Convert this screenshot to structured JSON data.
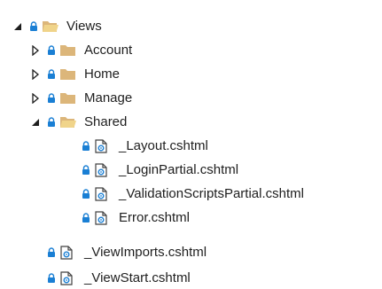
{
  "colors": {
    "folder": "#dcb67a",
    "folder_open_front": "#f0d48a",
    "lock": "#1a7fd4",
    "file_outline": "#424242",
    "file_badge": "#1a7fd4",
    "arrow": "#1e1e1e"
  },
  "tree": {
    "root": {
      "label": "Views",
      "state": "expanded",
      "icon": "folder-open-icon"
    },
    "folders": [
      {
        "label": "Account",
        "state": "collapsed",
        "icon": "folder-closed-icon"
      },
      {
        "label": "Home",
        "state": "collapsed",
        "icon": "folder-closed-icon"
      },
      {
        "label": "Manage",
        "state": "collapsed",
        "icon": "folder-closed-icon"
      },
      {
        "label": "Shared",
        "state": "expanded",
        "icon": "folder-open-icon"
      }
    ],
    "shared_files": [
      {
        "label": "_Layout.cshtml",
        "icon": "razor-file-icon"
      },
      {
        "label": "_LoginPartial.cshtml",
        "icon": "razor-file-icon"
      },
      {
        "label": "_ValidationScriptsPartial.cshtml",
        "icon": "razor-file-icon"
      },
      {
        "label": "Error.cshtml",
        "icon": "razor-file-icon"
      }
    ],
    "view_files": [
      {
        "label": "_ViewImports.cshtml",
        "icon": "razor-file-icon"
      },
      {
        "label": "_ViewStart.cshtml",
        "icon": "razor-file-icon"
      }
    ]
  }
}
